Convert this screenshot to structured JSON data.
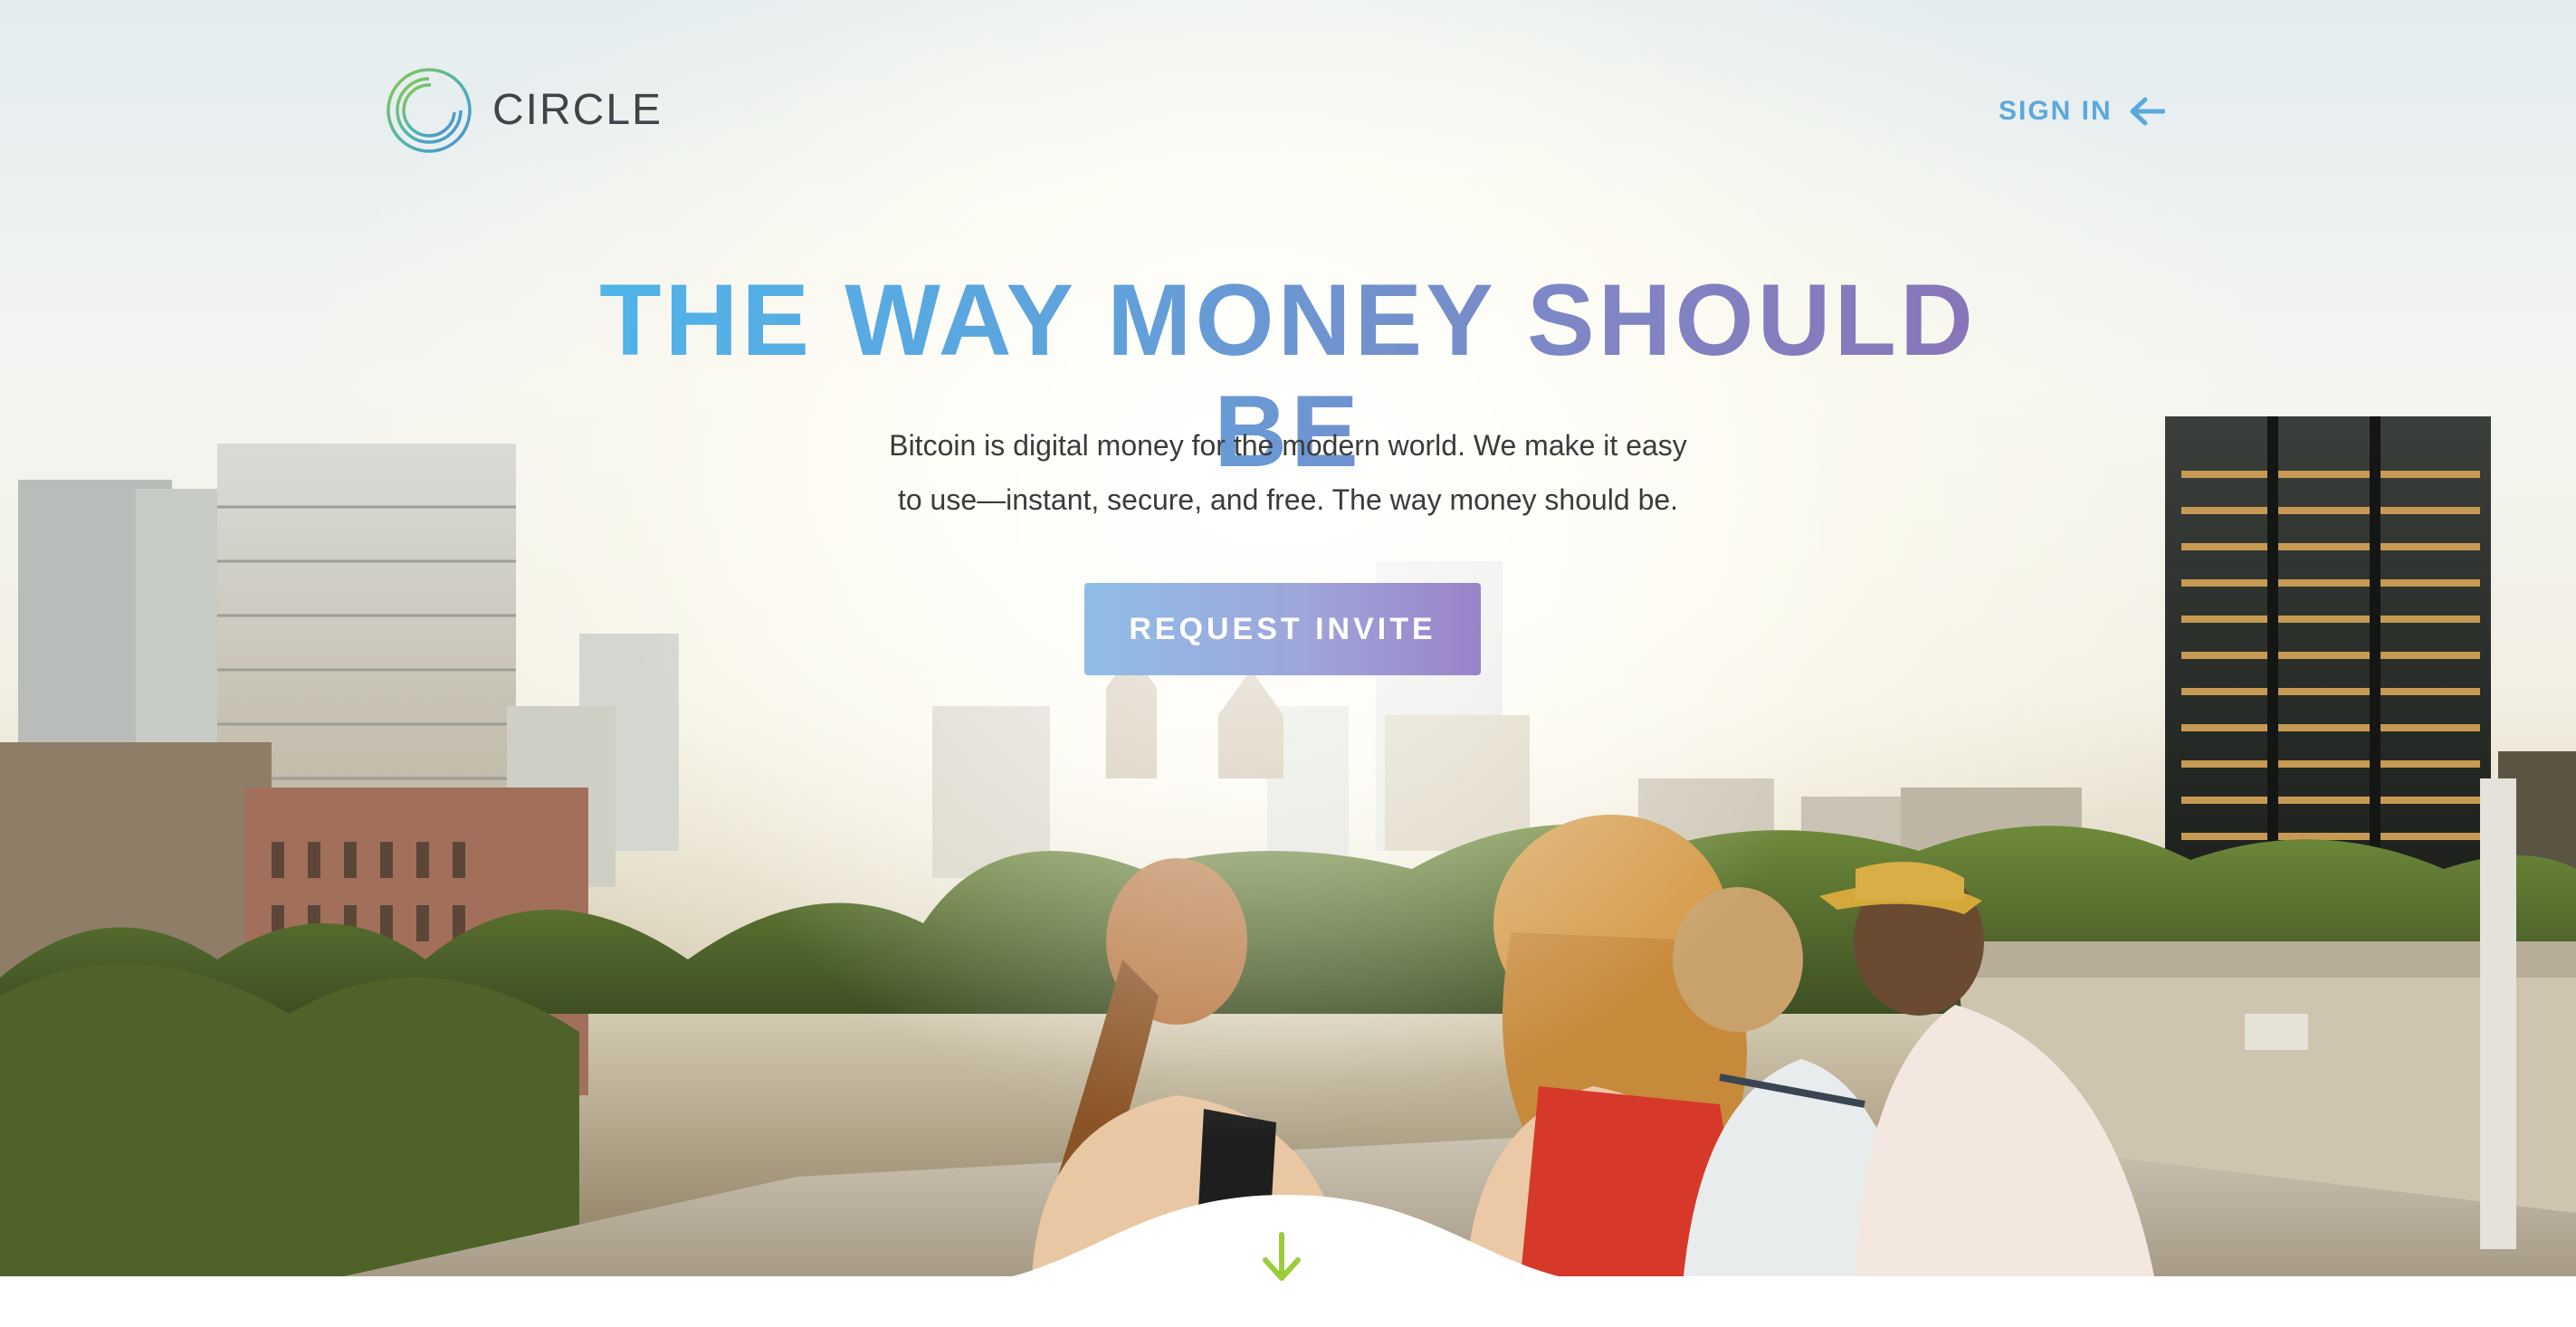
{
  "header": {
    "brand": "CIRCLE",
    "logo_icon": "circle-logo-icon",
    "sign_in_label": "SIGN IN",
    "sign_in_icon": "arrow-left-icon"
  },
  "hero": {
    "headline": "THE WAY MONEY SHOULD BE",
    "subtext_line1": "Bitcoin is digital money for the modern world. We make it easy",
    "subtext_line2": "to use—instant, secure, and free. The way money should be.",
    "cta_label": "REQUEST INVITE",
    "scroll_icon": "arrow-down-icon"
  },
  "colors": {
    "brand_blue": "#5ba8dc",
    "headline_start": "#4eb6ea",
    "headline_end": "#8a72b8",
    "scroll_arrow": "#9ccc3c"
  }
}
